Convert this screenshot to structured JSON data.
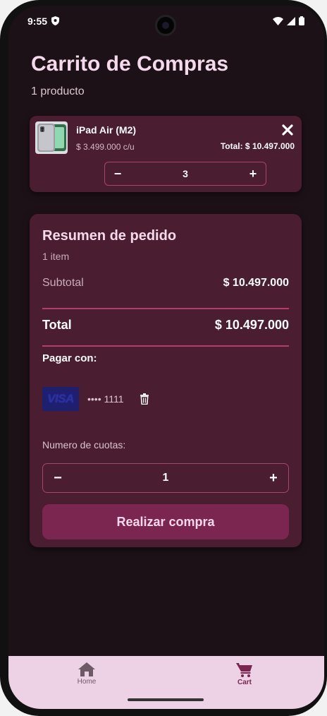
{
  "status_bar": {
    "time": "9:55"
  },
  "page": {
    "title": "Carrito de Compras",
    "product_count": "1 producto"
  },
  "cart_item": {
    "name": "iPad Air (M2)",
    "unit_price": "$ 3.499.000 c/u",
    "total": "Total: $ 10.497.000",
    "quantity": "3",
    "decrement": "−",
    "increment": "+"
  },
  "summary": {
    "title": "Resumen de pedido",
    "items": "1 item",
    "subtotal_label": "Subtotal",
    "subtotal_value": "$ 10.497.000",
    "total_label": "Total",
    "total_value": "$ 10.497.000",
    "pay_with": "Pagar con:",
    "card_brand": "VISA",
    "card_number": "•••• 1111",
    "cuotas_label": "Numero de cuotas:",
    "cuotas_value": "1",
    "decrement": "−",
    "increment": "+",
    "checkout_label": "Realizar compra"
  },
  "nav": {
    "home_label": "Home",
    "cart_label": "Cart"
  },
  "colors": {
    "background": "#1c1117",
    "card": "#4a1d30",
    "accent": "#7b2551",
    "title": "#f5d9ec",
    "nav_background": "#ecd2e4"
  },
  "icons": [
    "shield-icon",
    "wifi-icon",
    "signal-icon",
    "battery-icon",
    "close-icon",
    "trash-icon",
    "home-icon",
    "cart-icon"
  ]
}
